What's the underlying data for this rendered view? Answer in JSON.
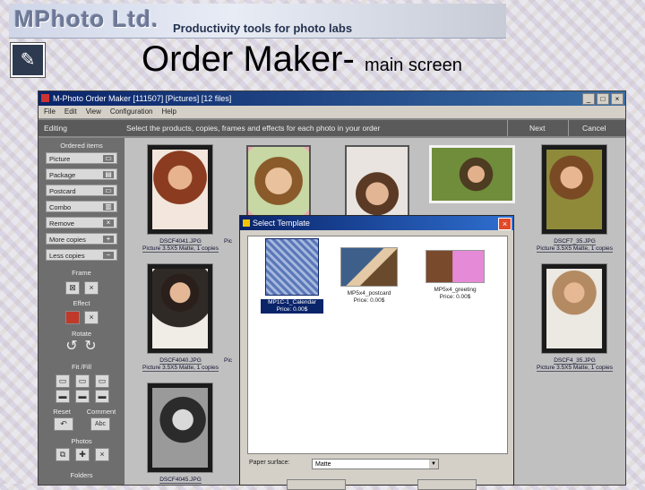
{
  "slide": {
    "logo": "MPhoto Ltd.",
    "tagline": "Productivity tools for photo labs",
    "title": "Order Maker-",
    "subtitle": "main screen",
    "corner_icon": "edit-icon"
  },
  "window": {
    "title": "M-Photo Order Maker [111507] [Pictures] [12 files]",
    "menu": [
      "File",
      "Edit",
      "View",
      "Configuration",
      "Help"
    ],
    "toolbar": {
      "mode": "Editing",
      "instruction": "Select the products, copies, frames and effects for each photo in your order",
      "next": "Next",
      "cancel": "Cancel"
    }
  },
  "panel": {
    "header": "Ordered items",
    "buttons": [
      {
        "label": "Picture",
        "icon": "picture-icon"
      },
      {
        "label": "Package",
        "icon": "package-icon"
      },
      {
        "label": "Postcard",
        "icon": "postcard-icon"
      },
      {
        "label": "Combo",
        "icon": "combo-icon"
      },
      {
        "label": "Remove",
        "icon": "×"
      },
      {
        "label": "More copies",
        "icon": "+"
      },
      {
        "label": "Less copies",
        "icon": "−"
      }
    ],
    "frame_label": "Frame",
    "effect_label": "Effect",
    "rotate_label": "Rotate",
    "fit_label": "Fit /Fill",
    "reset_label": "Reset",
    "comment_label": "Comment",
    "comment_btn": "Abc",
    "photos_label": "Photos",
    "folders_label": "Folders"
  },
  "grid": {
    "captions": [
      {
        "file": "DSCF4041.JPG",
        "desc": "Picture 3.5X5 Matte, 1 copies"
      },
      {
        "file": "",
        "desc": "Pic"
      },
      {
        "file": "",
        "desc": ""
      },
      {
        "file": "",
        "desc": ""
      },
      {
        "file": "DSCF7_35.JPG",
        "desc": "Picture 3.5X5 Matte, 1 copies"
      },
      {
        "file": "DSCF4040.JPG",
        "desc": "Picture 3.5X5 Matte, 1 copies"
      },
      {
        "file": "",
        "desc": "Pic"
      },
      {
        "file": "",
        "desc": ""
      },
      {
        "file": "",
        "desc": ""
      },
      {
        "file": "DSCF4_35.JPG",
        "desc": "Picture 3.5X5 Matte, 1 copies"
      },
      {
        "file": "DSCF4045.JPG",
        "desc": ""
      }
    ]
  },
  "dialog": {
    "title": "Select Template",
    "close": "×",
    "templates": [
      {
        "name": "MP1C-1_Calendar",
        "price": "Price: 0.00$"
      },
      {
        "name": "MP5x4_postcard",
        "price": "Price: 0.00$"
      },
      {
        "name": "MP5x4_greeting",
        "price": "Price: 0.00$"
      }
    ],
    "paper_label": "Paper surface:",
    "paper_value": "Matte"
  }
}
